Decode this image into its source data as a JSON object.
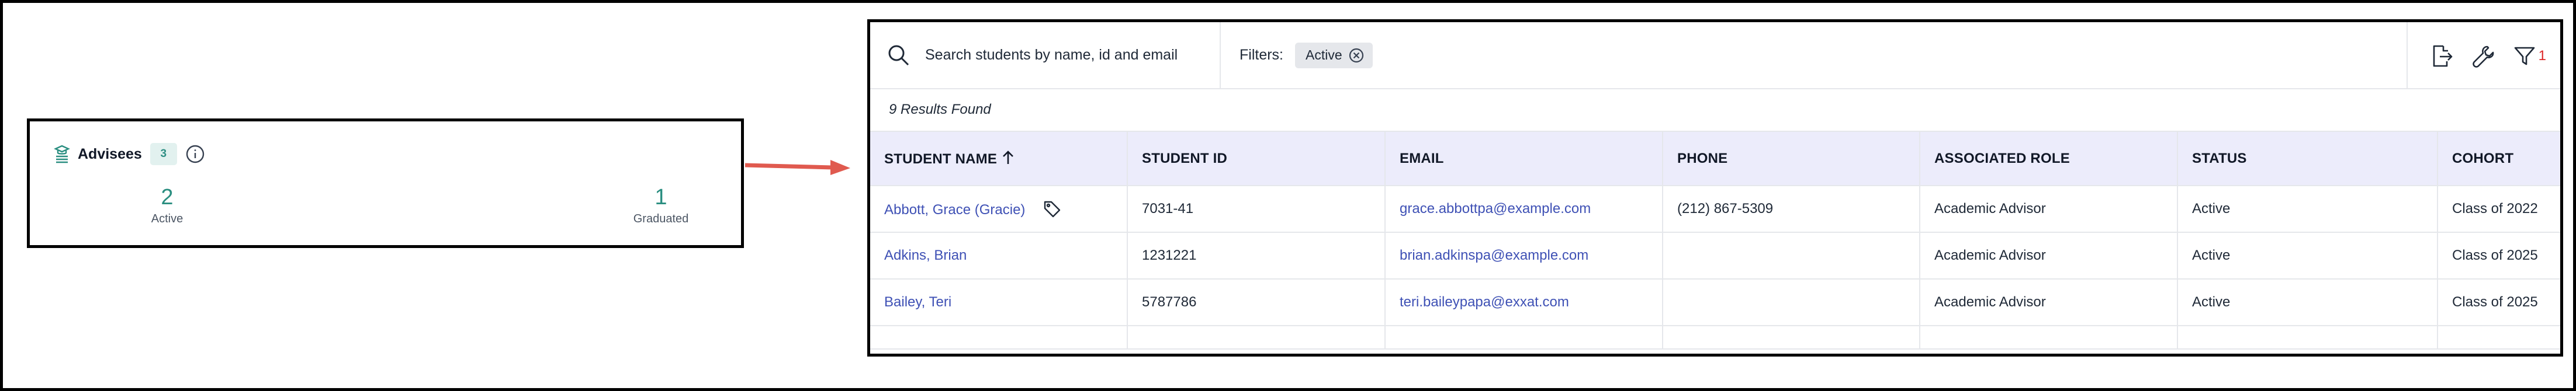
{
  "advisees": {
    "title": "Advisees",
    "count": "3",
    "icons": {
      "header": "advisees-icon",
      "info": "info-icon"
    },
    "stats": [
      {
        "value": "2",
        "label": "Active"
      },
      {
        "value": "1",
        "label": "Graduated"
      }
    ]
  },
  "arrow": {
    "color": "#e05a4f"
  },
  "toolbar": {
    "search_placeholder": "Search students by name, id and email",
    "filters_label": "Filters:",
    "filter_chip": "Active",
    "filter_count": "1",
    "icons": [
      "search-icon",
      "export-icon",
      "wrench-icon",
      "filter-icon"
    ]
  },
  "results_text": "9 Results Found",
  "table": {
    "columns": [
      "STUDENT NAME",
      "STUDENT ID",
      "EMAIL",
      "PHONE",
      "ASSOCIATED ROLE",
      "STATUS",
      "COHORT"
    ],
    "rows": [
      {
        "name": "Abbott, Grace (Gracie)",
        "id": "7031-41",
        "email": "grace.abbottpa@example.com",
        "phone": "(212) 867-5309",
        "role": "Academic Advisor",
        "status": "Active",
        "cohort": "Class of 2022"
      },
      {
        "name": "Adkins, Brian",
        "id": "1231221",
        "email": "brian.adkinspa@example.com",
        "phone": "",
        "role": "Academic Advisor",
        "status": "Active",
        "cohort": "Class of 2025"
      },
      {
        "name": "Bailey, Teri",
        "id": "5787786",
        "email": "teri.baileypapa@exxat.com",
        "phone": "",
        "role": "Academic Advisor",
        "status": "Active",
        "cohort": "Class of 2025"
      }
    ]
  },
  "colors": {
    "accent_teal": "#2a8e80",
    "link": "#3f51b5",
    "header_bg": "#ececfb",
    "badge_red": "#dc2626"
  }
}
